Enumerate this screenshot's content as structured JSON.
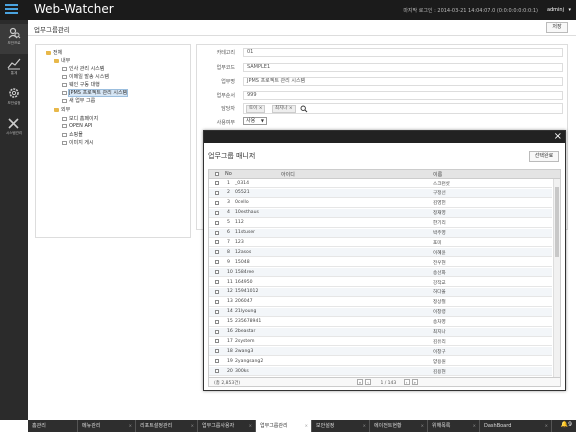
{
  "header": {
    "title": "Web-Watcher",
    "last_login": "마지막 로그인 : 2014-03-21 14:04:07.0 (0:0:0:0:0:0:0:1)",
    "user": "adminj",
    "user_caret": "▾"
  },
  "sidebar": {
    "items": [
      {
        "label": "보안프로",
        "icon": "search-person-icon"
      },
      {
        "label": "통계",
        "icon": "chart-icon"
      },
      {
        "label": "보안설정",
        "icon": "gear-icon"
      },
      {
        "label": "시스템관리",
        "icon": "tools-icon"
      }
    ]
  },
  "page": {
    "title": "업무그룹관리",
    "save_label": "저장"
  },
  "tree": {
    "root": "전체",
    "internal": "내부",
    "internal_children": [
      "인사 관리 시스템",
      "이메일 발송 시스템",
      "웨인 구동 대행",
      "JPMS 프로젝트 관리 시스템",
      "새 업무 그룹"
    ],
    "inside2": [
      "보디 홈페이지",
      "OPEN API",
      "쇼핑몰",
      "이미지 게시"
    ],
    "external": "외부"
  },
  "form": {
    "category_label": "카테고리",
    "category_value": "01",
    "code_label": "업무코드",
    "code_value": "SAMPLE1",
    "name_label": "업무명",
    "name_value": "JPMS 프로젝트 관리 시스템",
    "order_label": "업무순서",
    "order_value": "999",
    "manager_label": "담당자",
    "managers": [
      "토이 ×",
      "최지나 ×"
    ],
    "use_label": "사용여부",
    "use_value": "사용"
  },
  "modal": {
    "title": "업무그룹 매니저",
    "confirm_label": "선택완료",
    "close": "×",
    "col_no": "No",
    "col_id": "아이디",
    "col_name": "이름",
    "rows": [
      {
        "no": "1",
        "id": "_0314",
        "name": "스크런샷"
      },
      {
        "no": "2",
        "id": "05521",
        "name": "구정선"
      },
      {
        "no": "3",
        "id": "0cello",
        "name": "김영헌"
      },
      {
        "no": "4",
        "id": "10esthaus",
        "name": "정재영"
      },
      {
        "no": "5",
        "id": "112",
        "name": "한기리"
      },
      {
        "no": "6",
        "id": "11stuser",
        "name": "박주영"
      },
      {
        "no": "7",
        "id": "123",
        "name": "포미"
      },
      {
        "no": "8",
        "id": "12asos",
        "name": "이혜윤"
      },
      {
        "no": "9",
        "id": "15048",
        "name": "전우현"
      },
      {
        "no": "10",
        "id": "1584ree",
        "name": "송선화"
      },
      {
        "no": "11",
        "id": "164950",
        "name": "강작교"
      },
      {
        "no": "12",
        "id": "15941012",
        "name": "허다올"
      },
      {
        "no": "13",
        "id": "206047",
        "name": "정상철"
      },
      {
        "no": "14",
        "id": "21lyoung",
        "name": "이창령"
      },
      {
        "no": "15",
        "id": "235678941",
        "name": "송차영"
      },
      {
        "no": "16",
        "id": "2beastar",
        "name": "최지나"
      },
      {
        "no": "17",
        "id": "2system",
        "name": "김유리"
      },
      {
        "no": "18",
        "id": "2wang3",
        "name": "이창구"
      },
      {
        "no": "19",
        "id": "2yangsang2",
        "name": "양용원"
      },
      {
        "no": "20",
        "id": "300ks",
        "name": "김용현"
      }
    ],
    "total": "(총 2,853건)",
    "page_info": "1 / 143",
    "first": "«",
    "prev": "‹",
    "next": "›",
    "last": "»"
  },
  "bottom_tabs": [
    {
      "label": "홈관리"
    },
    {
      "label": "메뉴관리"
    },
    {
      "label": "리포트설정관리"
    },
    {
      "label": "업무그룹사용자"
    },
    {
      "label": "업무그룹관리"
    },
    {
      "label": "보안설정"
    },
    {
      "label": "에이전트현황"
    },
    {
      "label": "위해목록"
    },
    {
      "label": "DashBoard"
    }
  ],
  "bell_count": "9"
}
